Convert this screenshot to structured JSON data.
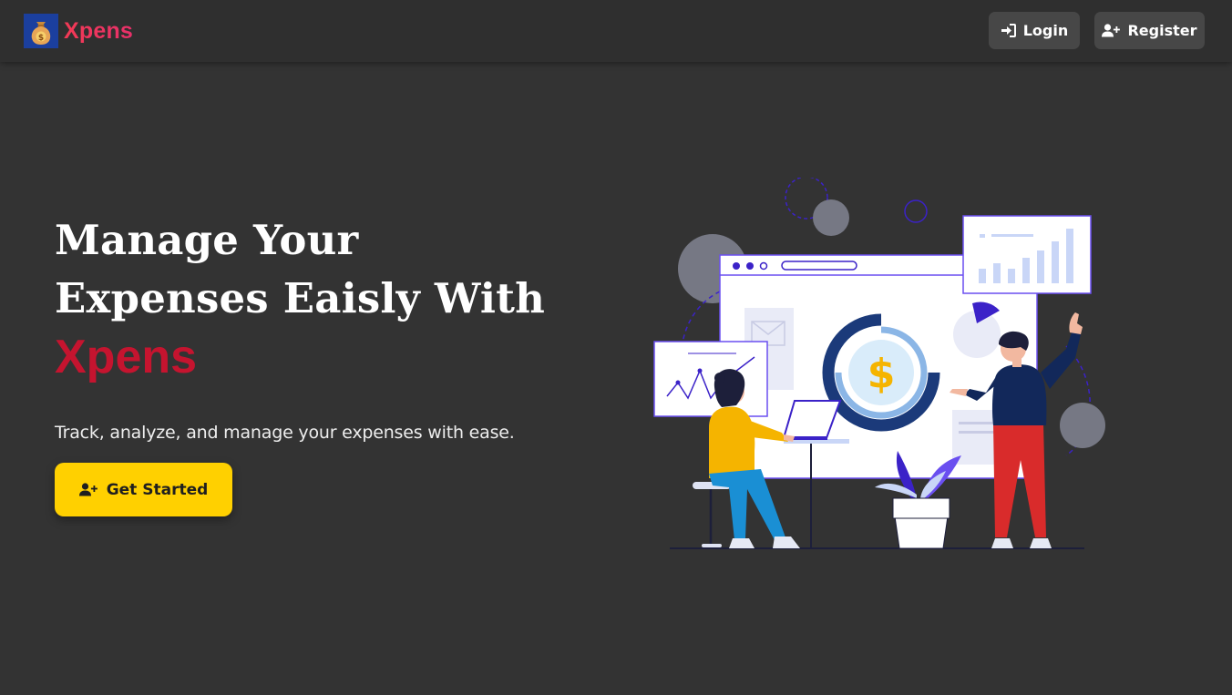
{
  "navbar": {
    "brand_name": "Xpens",
    "logo_icon": "money-bag-icon",
    "login_label": "Login",
    "register_label": "Register"
  },
  "hero": {
    "title_line_1": "Manage Your",
    "title_line_2": "Expenses Eaisly With",
    "brand_highlight": "Xpens",
    "subtitle": "Track, analyze, and manage your expenses with ease.",
    "cta_label": "Get Started"
  },
  "illustration": {
    "currency_symbol": "$"
  },
  "colors": {
    "background": "#333333",
    "navbar": "#2f2f2f",
    "nav_button": "#474747",
    "brand_gradient_start": "#f23a55",
    "brand_highlight": "#c5142f",
    "cta": "#ffd000"
  }
}
